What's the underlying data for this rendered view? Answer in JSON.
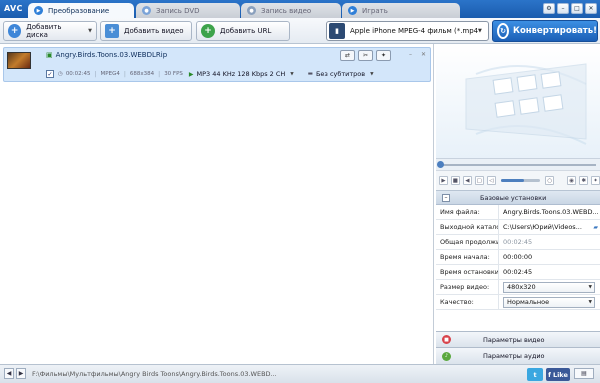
{
  "app": {
    "logo": "AVC"
  },
  "tabs": [
    {
      "label": "Преобразование",
      "active": true
    },
    {
      "label": "Запись DVD",
      "active": false
    },
    {
      "label": "Запись видео",
      "active": false
    },
    {
      "label": "Играть",
      "active": false
    }
  ],
  "toolbar": {
    "add_disc_label": "Добавить диска",
    "add_video_label": "Добавить видео",
    "add_url_label": "Добавить URL",
    "format_value": "Apple iPhone MPEG-4 фильм (*.mp4)",
    "convert_label": "Конвертировать!"
  },
  "file": {
    "name": "Angry.Birds.Toons.03.WEBDLRip",
    "duration": "00:02:45",
    "codec": "MPEG4",
    "resolution": "688x384",
    "fps": "30 FPS",
    "audio": "MP3 44 KHz 128 Kbps 2 CH",
    "subtitles": "Без субтитров"
  },
  "settings": {
    "title": "Базовые установки",
    "rows": [
      {
        "label": "Имя файла:",
        "value": "Angry.Birds.Toons.03.WEBD..."
      },
      {
        "label": "Выходной каталог:",
        "value": "C:\\Users\\Юрий\\Videos..."
      },
      {
        "label": "Общая продолжит",
        "value": "00:02:45"
      },
      {
        "label": "Время начала:",
        "value": "00:00:00"
      },
      {
        "label": "Время остановки:",
        "value": "00:02:45"
      },
      {
        "label": "Размер видео:",
        "value": "480x320"
      },
      {
        "label": "Качество:",
        "value": "Нормальное"
      }
    ],
    "video_params_label": "Параметры видео",
    "audio_params_label": "Параметры аудио"
  },
  "status": {
    "path": "F:\\Фильмы\\Мультфильмы\\Angry Birds Toons\\Angry.Birds.Toons.03.WEBD...",
    "like_label": "Like"
  },
  "colors": {
    "titlebar": "#1f66bb",
    "accent": "#2b78d4",
    "selection": "#d3e6fa",
    "convert": "#2a7ad0"
  }
}
